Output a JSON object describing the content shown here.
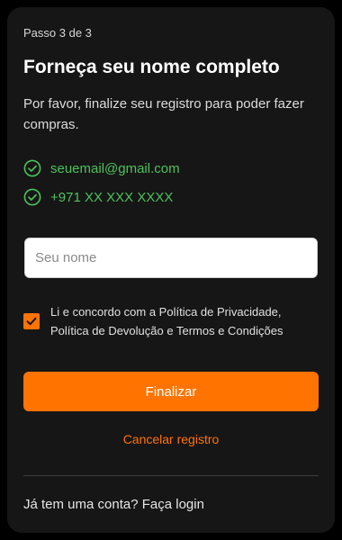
{
  "step": {
    "label": "Passo 3 de 3"
  },
  "header": {
    "title": "Forneça seu nome completo",
    "subtitle": "Por favor, finalize seu registro para poder fazer compras."
  },
  "verified": {
    "email": "seuemail@gmail.com",
    "phone": "+971 XX XXX XXXX"
  },
  "form": {
    "name_placeholder": "Seu nome",
    "name_value": "",
    "terms_checked": true,
    "terms_text": "Li e concordo com a Política de Privacidade, Política de Devolução e Termos e Condições",
    "submit_label": "Finalizar",
    "cancel_label": "Cancelar registro"
  },
  "footer": {
    "login_text": "Já tem uma conta? Faça login"
  },
  "colors": {
    "accent": "#ff7300",
    "success": "#4cc25a",
    "background": "#161616"
  },
  "icons": {
    "verified": "check-circle-icon",
    "checkbox": "checkmark-icon"
  }
}
